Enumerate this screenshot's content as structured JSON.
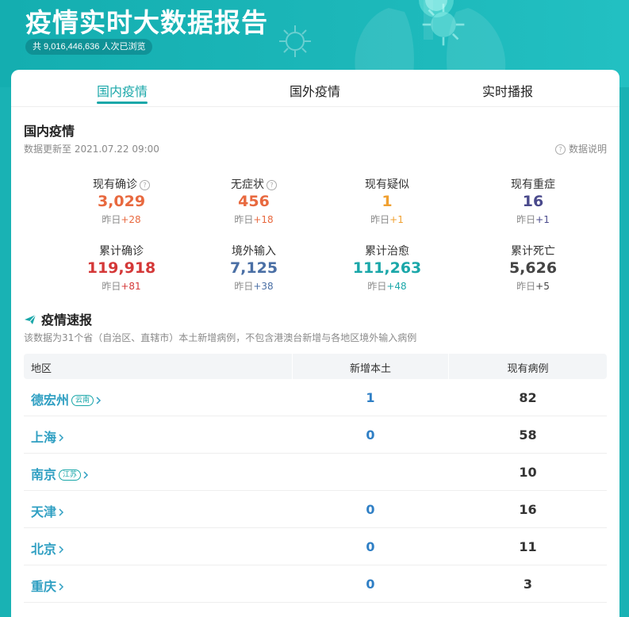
{
  "header": {
    "title": "疫情实时大数据报告",
    "views": "共 9,016,446,636 人次已浏览"
  },
  "tabs": [
    {
      "label": "国内疫情",
      "active": true
    },
    {
      "label": "国外疫情",
      "active": false
    },
    {
      "label": "实时播报",
      "active": false
    }
  ],
  "domestic": {
    "title": "国内疫情",
    "update_time": "数据更新至 2021.07.22 09:00",
    "data_note": "数据说明",
    "stats": [
      {
        "label": "现有确诊",
        "has_help": true,
        "value": "3,029",
        "delta_prefix": "昨日",
        "delta": "+28",
        "color": "#e8693f",
        "delta_color": "#e8693f"
      },
      {
        "label": "无症状",
        "has_help": true,
        "value": "456",
        "delta_prefix": "昨日",
        "delta": "+18",
        "color": "#e8693f",
        "delta_color": "#e8693f"
      },
      {
        "label": "现有疑似",
        "has_help": false,
        "value": "1",
        "delta_prefix": "昨日",
        "delta": "+1",
        "color": "#f0a030",
        "delta_color": "#f0a030"
      },
      {
        "label": "现有重症",
        "has_help": false,
        "value": "16",
        "delta_prefix": "昨日",
        "delta": "+1",
        "color": "#4a4a8c",
        "delta_color": "#4a4a8c"
      },
      {
        "label": "累计确诊",
        "has_help": false,
        "value": "119,918",
        "delta_prefix": "昨日",
        "delta": "+81",
        "color": "#d43838",
        "delta_color": "#d43838"
      },
      {
        "label": "境外输入",
        "has_help": false,
        "value": "7,125",
        "delta_prefix": "昨日",
        "delta": "+38",
        "color": "#4a6fa5",
        "delta_color": "#4a6fa5"
      },
      {
        "label": "累计治愈",
        "has_help": false,
        "value": "111,263",
        "delta_prefix": "昨日",
        "delta": "+48",
        "color": "#1aa7a9",
        "delta_color": "#1aa7a9"
      },
      {
        "label": "累计死亡",
        "has_help": false,
        "value": "5,626",
        "delta_prefix": "昨日",
        "delta": "+5",
        "color": "#444444",
        "delta_color": "#444444"
      }
    ]
  },
  "flash": {
    "title": "疫情速报",
    "desc": "该数据为31个省（自治区、直辖市）本土新增病例，不包含港澳台新增与各地区境外输入病例",
    "columns": [
      "地区",
      "新增本土",
      "现有病例"
    ],
    "rows": [
      {
        "region": "德宏州",
        "province": "云南",
        "new_local": "1",
        "current": "82"
      },
      {
        "region": "上海",
        "province": "",
        "new_local": "0",
        "current": "58"
      },
      {
        "region": "南京",
        "province": "江苏",
        "new_local": "",
        "current": "10"
      },
      {
        "region": "天津",
        "province": "",
        "new_local": "0",
        "current": "16"
      },
      {
        "region": "北京",
        "province": "",
        "new_local": "0",
        "current": "11"
      },
      {
        "region": "重庆",
        "province": "",
        "new_local": "0",
        "current": "3"
      }
    ]
  },
  "colors": {
    "accent": "#1aa7a9",
    "header_bg": "#19b2b4",
    "region_link": "#2f9fc2",
    "new_local": "#2f7fc5"
  },
  "icons": {
    "help": "question-circle-icon",
    "flash": "paper-plane-icon",
    "row": "chevron-right-icon"
  }
}
